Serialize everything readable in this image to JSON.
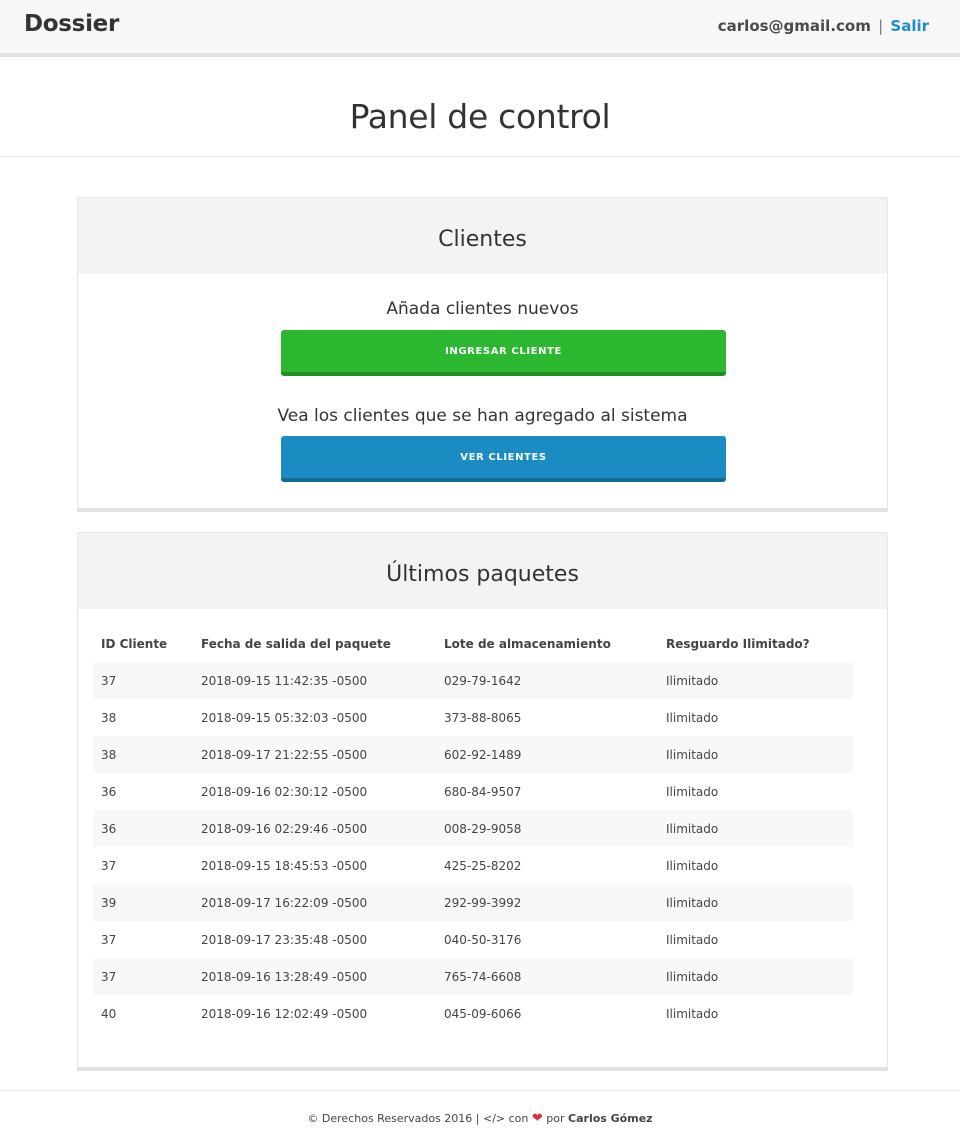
{
  "nav": {
    "brand": "Dossier",
    "user_email": "carlos@gmail.com",
    "separator": "|",
    "logout_label": "Salir"
  },
  "header": {
    "title": "Panel de control"
  },
  "clients_panel": {
    "title": "Clientes",
    "add_prompt": "Añada clientes nuevos",
    "add_button": "INGRESAR CLIENTE",
    "view_prompt": "Vea los clientes que se han agregado al sistema",
    "view_button": "VER CLIENTES"
  },
  "packages_panel": {
    "title": "Últimos paquetes",
    "columns": [
      "ID Cliente",
      "Fecha de salida del paquete",
      "Lote de almacenamiento",
      "Resguardo Ilimitado?"
    ],
    "rows": [
      [
        "37",
        "2018-09-15 11:42:35 -0500",
        "029-79-1642",
        "Ilimitado"
      ],
      [
        "38",
        "2018-09-15 05:32:03 -0500",
        "373-88-8065",
        "Ilimitado"
      ],
      [
        "38",
        "2018-09-17 21:22:55 -0500",
        "602-92-1489",
        "Ilimitado"
      ],
      [
        "36",
        "2018-09-16 02:30:12 -0500",
        "680-84-9507",
        "Ilimitado"
      ],
      [
        "36",
        "2018-09-16 02:29:46 -0500",
        "008-29-9058",
        "Ilimitado"
      ],
      [
        "37",
        "2018-09-15 18:45:53 -0500",
        "425-25-8202",
        "Ilimitado"
      ],
      [
        "39",
        "2018-09-17 16:22:09 -0500",
        "292-99-3992",
        "Ilimitado"
      ],
      [
        "37",
        "2018-09-17 23:35:48 -0500",
        "040-50-3176",
        "Ilimitado"
      ],
      [
        "37",
        "2018-09-16 13:28:49 -0500",
        "765-74-6608",
        "Ilimitado"
      ],
      [
        "40",
        "2018-09-16 12:02:49 -0500",
        "045-09-6066",
        "Ilimitado"
      ]
    ]
  },
  "footer": {
    "copyright": "© Derechos Reservados 2016 | </> con",
    "heart_icon": "heart-icon",
    "by": "por",
    "author": "Carlos Gómez"
  },
  "colors": {
    "accent_link": "#1f8dc9",
    "button_green": "#2bb830",
    "button_blue": "#1a8cc2",
    "heart": "#e0303a"
  }
}
